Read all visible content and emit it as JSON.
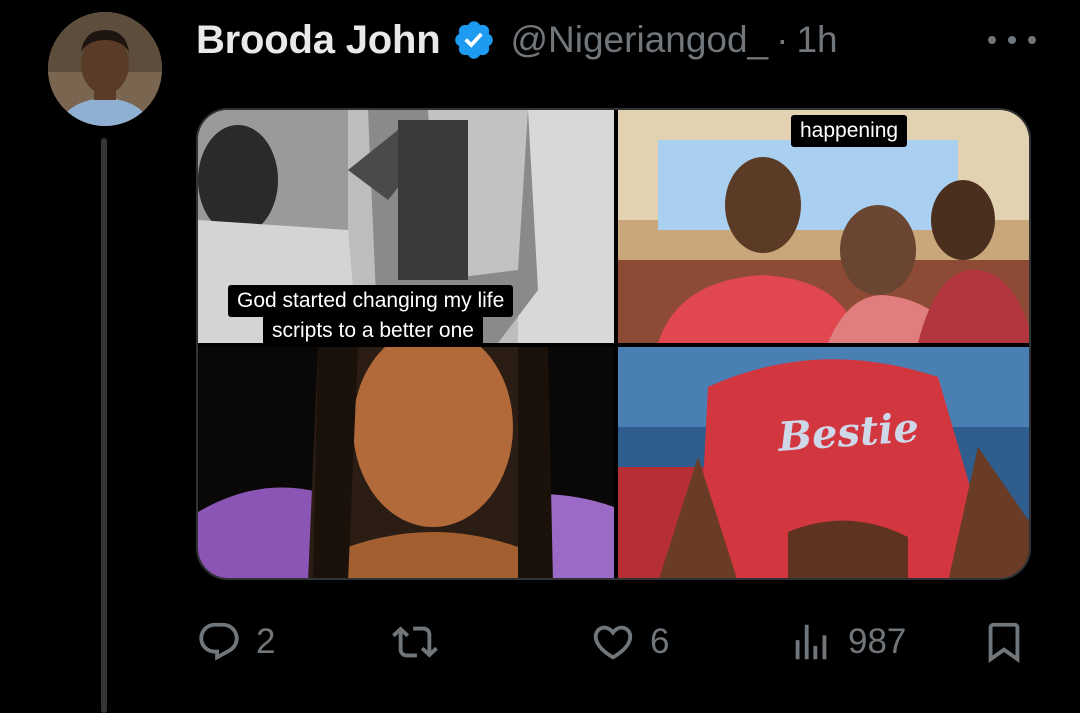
{
  "tweet": {
    "author_name": "Brooda John",
    "handle": "@Nigeriangod_",
    "separator": "·",
    "time": "1h",
    "verified_icon": "verified-badge-icon",
    "more_icon": "more-icon"
  },
  "media": {
    "tiles": [
      {
        "caption_lines": [
          "God started changing my life",
          "scripts to a better one"
        ]
      },
      {
        "caption_lines": [
          "happening"
        ]
      },
      {
        "caption_lines": []
      },
      {
        "shirt_text": "Bestie"
      }
    ]
  },
  "actions": {
    "reply_count": "2",
    "retweet_count": "",
    "like_count": "6",
    "views_count": "987",
    "icons": [
      "reply-icon",
      "retweet-icon",
      "like-icon",
      "views-icon",
      "bookmark-icon"
    ]
  },
  "colors": {
    "background": "#000000",
    "text_primary": "#e7e9ea",
    "text_secondary": "#71767b",
    "verified_blue": "#1d9bf0"
  }
}
